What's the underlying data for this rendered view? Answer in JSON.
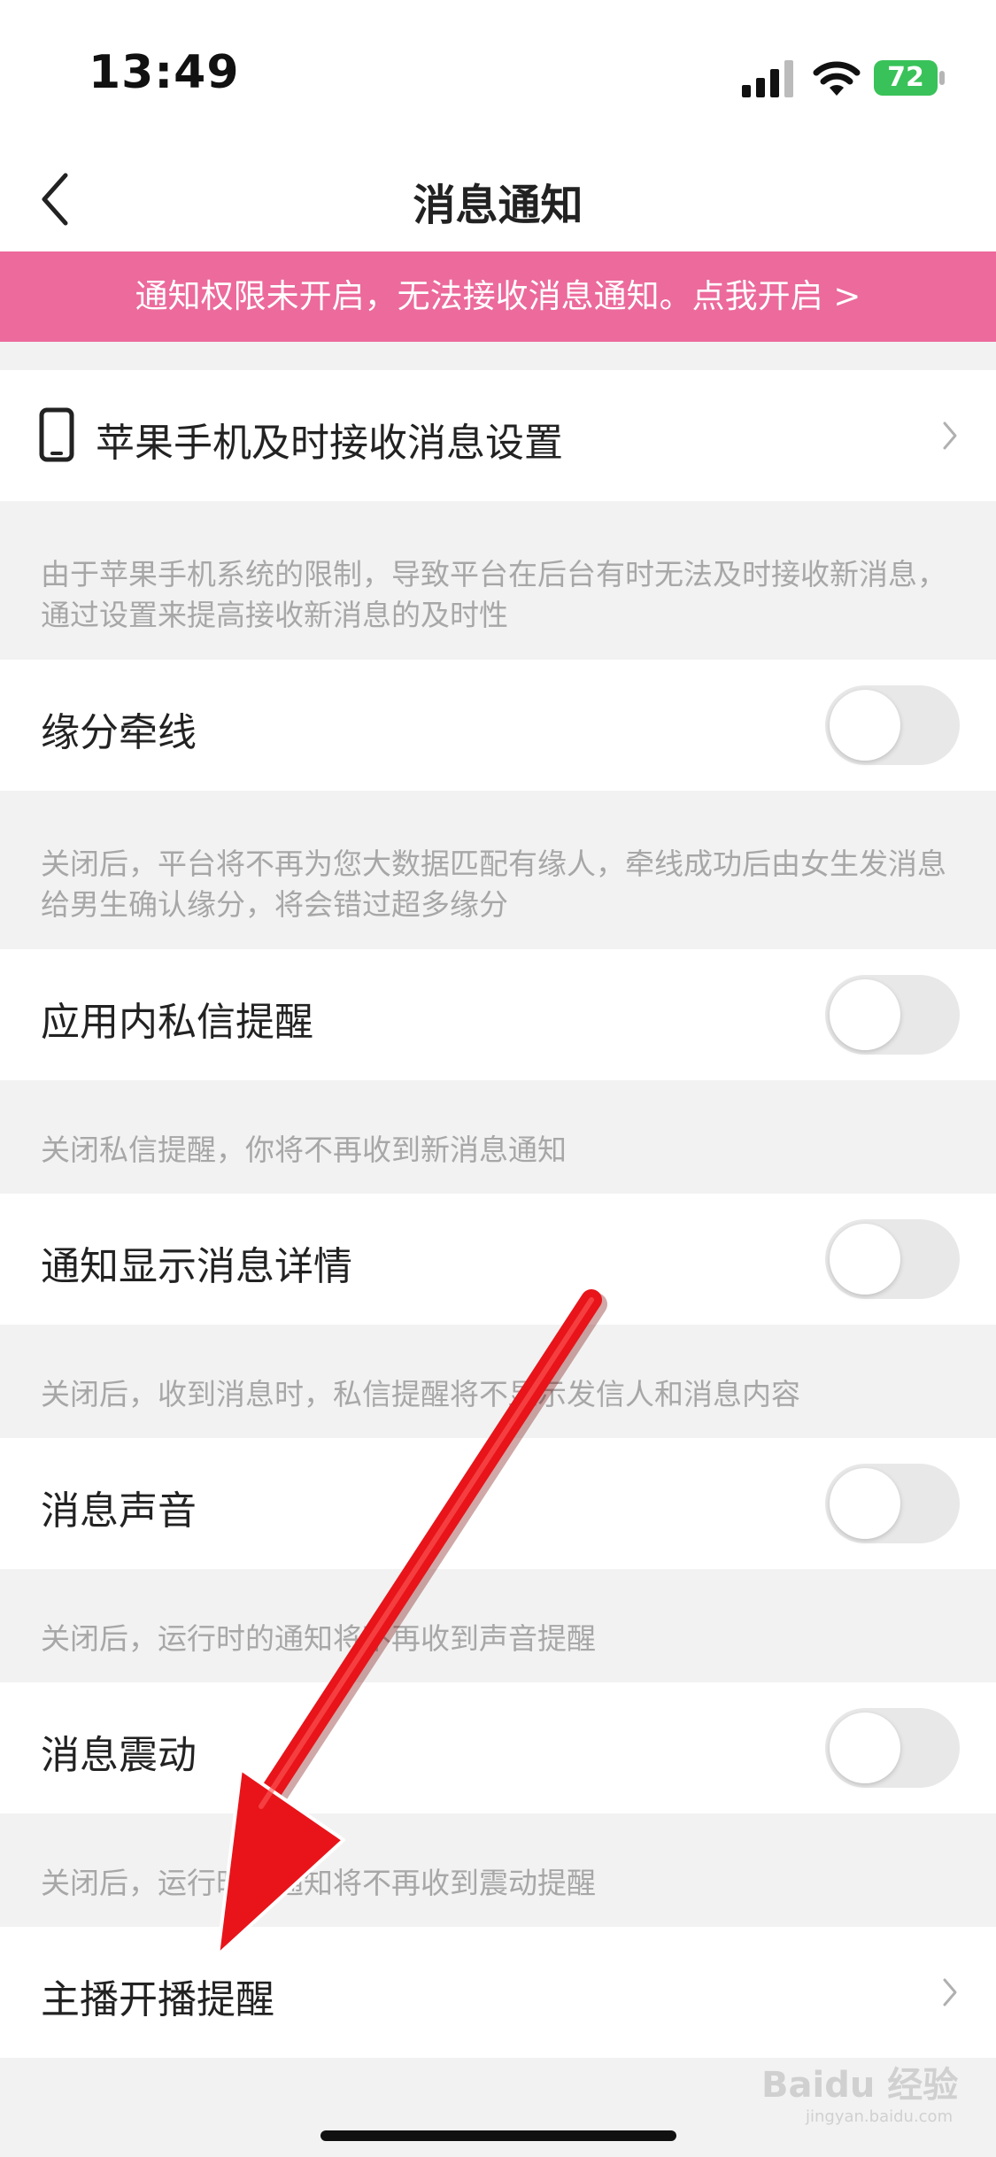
{
  "status_bar": {
    "time": "13:49",
    "battery": "72"
  },
  "nav": {
    "title": "消息通知"
  },
  "banner": {
    "text": "通知权限未开启，无法接收消息通知。点我开启 >"
  },
  "rows": {
    "iphone_settings": {
      "label": "苹果手机及时接收消息设置",
      "icon": "phone-icon"
    },
    "iphone_note": "由于苹果手机系统的限制，导致平台在后台有时无法及时接收新消息，通过设置来提高接收新消息的及时性",
    "matchmaking": {
      "label": "缘分牵线",
      "enabled": false
    },
    "matchmaking_note": "关闭后，平台将不再为您大数据匹配有缘人，牵线成功后由女生发消息给男生确认缘分，将会错过超多缘分",
    "in_app_dm": {
      "label": "应用内私信提醒",
      "enabled": false
    },
    "in_app_dm_note": "关闭私信提醒，你将不再收到新消息通知",
    "show_details": {
      "label": "通知显示消息详情",
      "enabled": false
    },
    "show_details_note": "关闭后，收到消息时，私信提醒将不显示发信人和消息内容",
    "sound": {
      "label": "消息声音",
      "enabled": false
    },
    "sound_note": "关闭后，运行时的通知将不再收到声音提醒",
    "vibration": {
      "label": "消息震动",
      "enabled": false
    },
    "vibration_note": "关闭后，运行时的通知将不再收到震动提醒",
    "anchor_live": {
      "label": "主播开播提醒"
    }
  },
  "watermark": {
    "brand": "Baidu 经验",
    "url": "jingyan.baidu.com"
  },
  "colors": {
    "banner": "#ec6a9c",
    "arrow": "#e8141a",
    "background": "#f2f2f2"
  }
}
